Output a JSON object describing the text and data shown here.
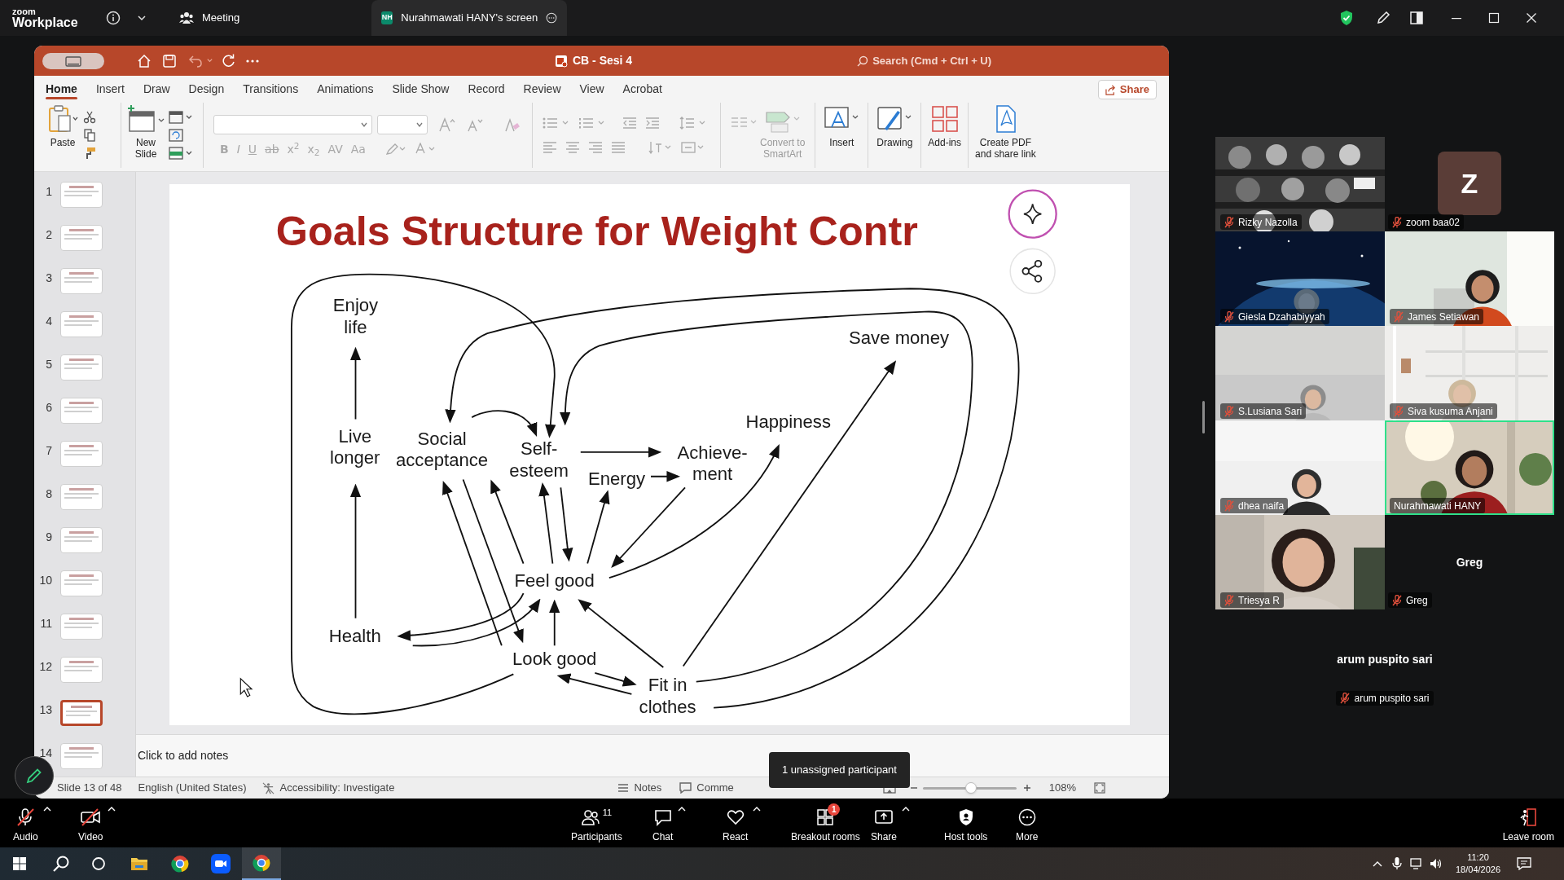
{
  "zoom_top_bar": {
    "logo_top": "zoom",
    "logo_bottom": "Workplace",
    "meeting_label": "Meeting",
    "share_tab": {
      "initials": "NH",
      "label": "Nurahmawati HANY's screen"
    }
  },
  "powerpoint": {
    "title": "CB - Sesi 4",
    "search": {
      "placeholder": "Search (Cmd + Ctrl + U)"
    },
    "tabs": [
      {
        "label": "Home",
        "selected": true
      },
      {
        "label": "Insert",
        "selected": false
      },
      {
        "label": "Draw",
        "selected": false
      },
      {
        "label": "Design",
        "selected": false
      },
      {
        "label": "Transitions",
        "selected": false
      },
      {
        "label": "Animations",
        "selected": false
      },
      {
        "label": "Slide Show",
        "selected": false
      },
      {
        "label": "Record",
        "selected": false
      },
      {
        "label": "Review",
        "selected": false
      },
      {
        "label": "View",
        "selected": false
      },
      {
        "label": "Acrobat",
        "selected": false
      }
    ],
    "share_button": "Share",
    "ribbon_buttons": [
      {
        "kind": "paste",
        "lines": [
          "Paste"
        ],
        "disabled": false
      },
      {
        "kind": "new-slide",
        "lines": [
          "New",
          "Slide"
        ],
        "disabled": false
      },
      {
        "kind": "smartart",
        "lines": [
          "Convert to",
          "SmartArt"
        ],
        "disabled": true
      },
      {
        "kind": "insert",
        "lines": [
          "Insert"
        ],
        "disabled": false
      },
      {
        "kind": "drawing",
        "lines": [
          "Drawing"
        ],
        "disabled": false
      },
      {
        "kind": "add-ins",
        "lines": [
          "Add-ins"
        ],
        "disabled": false
      },
      {
        "kind": "create-pdf",
        "lines": [
          "Create PDF",
          "and share link"
        ],
        "disabled": false
      }
    ],
    "format_buttons": [
      {
        "kind": "bold",
        "label": "B",
        "disabled": true
      },
      {
        "kind": "italic",
        "label": "I",
        "disabled": true
      },
      {
        "kind": "underline",
        "label": "U",
        "disabled": true
      },
      {
        "kind": "strikethrough",
        "label": "ab",
        "disabled": true
      },
      {
        "kind": "superscript",
        "label": "x$^{2}$",
        "disabled": true
      },
      {
        "kind": "subscript",
        "label": "x$_{2}$",
        "disabled": true
      },
      {
        "kind": "spacing",
        "label": "AV",
        "disabled": true
      },
      {
        "kind": "case",
        "label": "Aa",
        "disabled": true
      }
    ],
    "slides": [
      {
        "number": "1",
        "selected": false
      },
      {
        "number": "2",
        "selected": false
      },
      {
        "number": "3",
        "selected": false
      },
      {
        "number": "4",
        "selected": false
      },
      {
        "number": "5",
        "selected": false
      },
      {
        "number": "6",
        "selected": false
      },
      {
        "number": "7",
        "selected": false
      },
      {
        "number": "8",
        "selected": false
      },
      {
        "number": "9",
        "selected": false
      },
      {
        "number": "10",
        "selected": false
      },
      {
        "number": "11",
        "selected": false
      },
      {
        "number": "12",
        "selected": false
      },
      {
        "number": "13",
        "selected": true
      },
      {
        "number": "14",
        "selected": false
      }
    ],
    "slide": {
      "title": "Goals Structure for Weight Contr",
      "nodes": [
        {
          "lines": [
            "Enjoy",
            "life"
          ]
        },
        {
          "lines": [
            "Live",
            "longer"
          ]
        },
        {
          "lines": [
            "Social",
            "acceptance"
          ]
        },
        {
          "lines": [
            "Self-",
            "esteem"
          ]
        },
        {
          "lines": [
            "Energy"
          ]
        },
        {
          "lines": [
            "Achieve-",
            "ment"
          ]
        },
        {
          "lines": [
            "Happiness"
          ]
        },
        {
          "lines": [
            "Save money"
          ]
        },
        {
          "lines": [
            "Feel good"
          ]
        },
        {
          "lines": [
            "Health"
          ]
        },
        {
          "lines": [
            "Look good"
          ]
        },
        {
          "lines": [
            "Fit in",
            "clothes"
          ]
        }
      ]
    },
    "notes": {
      "placeholder": "Click to add notes"
    },
    "status_bar": {
      "slide": "Slide 13 of 48",
      "language": "English (United States)",
      "accessibility": "Accessibility: Investigate",
      "notes": "Notes",
      "comments": "Comme",
      "zoom_slider": {
        "level": 0.52
      },
      "zoom": "108%"
    }
  },
  "participants": [
    {
      "kind": "video",
      "name": "Rizky Nazolla",
      "muted": true,
      "speaking": false
    },
    {
      "kind": "avatar",
      "initial": "Z",
      "name": "zoom baa02",
      "muted": true,
      "speaking": false
    },
    {
      "kind": "video",
      "name": "Giesla Dzahabiyyah",
      "muted": true,
      "speaking": false
    },
    {
      "kind": "video",
      "name": "James Setiawan",
      "muted": true,
      "speaking": false
    },
    {
      "kind": "video",
      "name": "S.Lusiana Sari",
      "muted": true,
      "speaking": false
    },
    {
      "kind": "video",
      "name": "Siva kusuma Anjani",
      "muted": true,
      "speaking": false
    },
    {
      "kind": "video",
      "name": "dhea naifa",
      "muted": true,
      "speaking": false
    },
    {
      "kind": "video",
      "name": "Nurahmawati HANY",
      "muted": false,
      "speaking": true
    },
    {
      "kind": "video",
      "name": "Triesya R",
      "muted": true,
      "speaking": false
    },
    {
      "kind": "name",
      "display_name": "Greg",
      "name": "Greg",
      "muted": true,
      "speaking": false
    },
    {
      "kind": "name",
      "display_name": "arum puspito sari",
      "name": "arum puspito sari",
      "muted": true,
      "speaking": false
    }
  ],
  "toolbar": {
    "items": [
      {
        "kind": "audio",
        "label": "Audio",
        "off": true
      },
      {
        "kind": "video",
        "label": "Video",
        "off": true
      },
      {
        "kind": "participants",
        "label": "Participants",
        "count": "11"
      },
      {
        "kind": "chat",
        "label": "Chat"
      },
      {
        "kind": "react",
        "label": "React"
      },
      {
        "kind": "breakout",
        "label": "Breakout rooms",
        "badge": "1"
      },
      {
        "kind": "share",
        "label": "Share"
      },
      {
        "kind": "host",
        "label": "Host tools"
      },
      {
        "kind": "more",
        "label": "More"
      }
    ],
    "leave": "Leave room",
    "tooltip": "1 unassigned participant"
  },
  "taskbar": {
    "time": "11:20",
    "date": "18/04/2026"
  }
}
